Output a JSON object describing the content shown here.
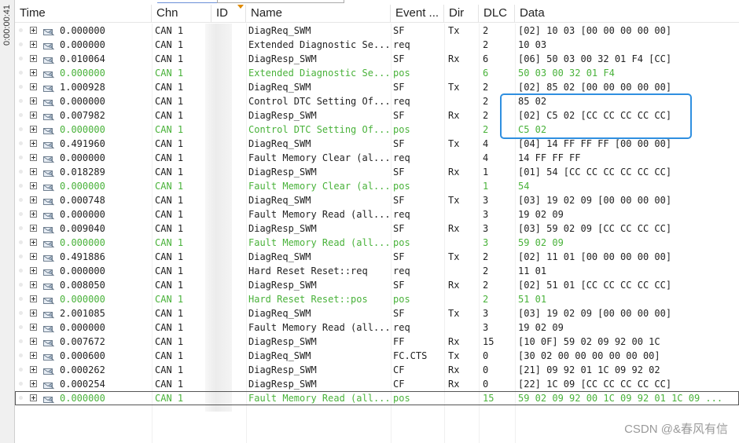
{
  "side_time": "0:00:00:41",
  "columns": {
    "time": "Time",
    "chn": "Chn",
    "id": "ID",
    "name": "Name",
    "event": "Event ...",
    "dir": "Dir",
    "dlc": "DLC",
    "data": "Data"
  },
  "rows": [
    {
      "time": "0.000000",
      "chn": "CAN 1",
      "name": "DiagReq_SWM",
      "event": "SF",
      "dir": "Tx",
      "dlc": "2",
      "data": "[02] 10 03 [00 00 00 00 00]",
      "green": false
    },
    {
      "time": "0.000000",
      "chn": "CAN 1",
      "name": "Extended Diagnostic Se...",
      "event": "req",
      "dir": "",
      "dlc": "2",
      "data": "10 03",
      "green": false
    },
    {
      "time": "0.010064",
      "chn": "CAN 1",
      "name": "DiagResp_SWM",
      "event": "SF",
      "dir": "Rx",
      "dlc": "6",
      "data": "[06] 50 03 00 32 01 F4 [CC]",
      "green": false
    },
    {
      "time": "0.000000",
      "chn": "CAN 1",
      "name": "Extended Diagnostic Se...",
      "event": "pos",
      "dir": "",
      "dlc": "6",
      "data": "50 03 00 32 01 F4",
      "green": true
    },
    {
      "time": "1.000928",
      "chn": "CAN 1",
      "name": "DiagReq_SWM",
      "event": "SF",
      "dir": "Tx",
      "dlc": "2",
      "data": "[02] 85 02 [00 00 00 00 00]",
      "green": false
    },
    {
      "time": "0.000000",
      "chn": "CAN 1",
      "name": "Control DTC Setting Of...",
      "event": "req",
      "dir": "",
      "dlc": "2",
      "data": "85 02",
      "green": false
    },
    {
      "time": "0.007982",
      "chn": "CAN 1",
      "name": "DiagResp_SWM",
      "event": "SF",
      "dir": "Rx",
      "dlc": "2",
      "data": "[02] C5 02 [CC CC CC CC CC]",
      "green": false
    },
    {
      "time": "0.000000",
      "chn": "CAN 1",
      "name": "Control DTC Setting Of...",
      "event": "pos",
      "dir": "",
      "dlc": "2",
      "data": "C5 02",
      "green": true
    },
    {
      "time": "0.491960",
      "chn": "CAN 1",
      "name": "DiagReq_SWM",
      "event": "SF",
      "dir": "Tx",
      "dlc": "4",
      "data": "[04] 14 FF FF FF [00 00 00]",
      "green": false
    },
    {
      "time": "0.000000",
      "chn": "CAN 1",
      "name": "Fault Memory Clear (al...",
      "event": "req",
      "dir": "",
      "dlc": "4",
      "data": "14 FF FF FF",
      "green": false
    },
    {
      "time": "0.018289",
      "chn": "CAN 1",
      "name": "DiagResp_SWM",
      "event": "SF",
      "dir": "Rx",
      "dlc": "1",
      "data": "[01] 54 [CC CC CC CC CC CC]",
      "green": false
    },
    {
      "time": "0.000000",
      "chn": "CAN 1",
      "name": "Fault Memory Clear (al...",
      "event": "pos",
      "dir": "",
      "dlc": "1",
      "data": "54",
      "green": true
    },
    {
      "time": "0.000748",
      "chn": "CAN 1",
      "name": "DiagReq_SWM",
      "event": "SF",
      "dir": "Tx",
      "dlc": "3",
      "data": "[03] 19 02 09 [00 00 00 00]",
      "green": false
    },
    {
      "time": "0.000000",
      "chn": "CAN 1",
      "name": "Fault Memory Read (all...",
      "event": "req",
      "dir": "",
      "dlc": "3",
      "data": "19 02 09",
      "green": false
    },
    {
      "time": "0.009040",
      "chn": "CAN 1",
      "name": "DiagResp_SWM",
      "event": "SF",
      "dir": "Rx",
      "dlc": "3",
      "data": "[03] 59 02 09 [CC CC CC CC]",
      "green": false
    },
    {
      "time": "0.000000",
      "chn": "CAN 1",
      "name": "Fault Memory Read (all...",
      "event": "pos",
      "dir": "",
      "dlc": "3",
      "data": "59 02 09",
      "green": true
    },
    {
      "time": "0.491886",
      "chn": "CAN 1",
      "name": "DiagReq_SWM",
      "event": "SF",
      "dir": "Tx",
      "dlc": "2",
      "data": "[02] 11 01 [00 00 00 00 00]",
      "green": false
    },
    {
      "time": "0.000000",
      "chn": "CAN 1",
      "name": "Hard Reset Reset::req",
      "event": "req",
      "dir": "",
      "dlc": "2",
      "data": "11 01",
      "green": false
    },
    {
      "time": "0.008050",
      "chn": "CAN 1",
      "name": "DiagResp_SWM",
      "event": "SF",
      "dir": "Rx",
      "dlc": "2",
      "data": "[02] 51 01 [CC CC CC CC CC]",
      "green": false
    },
    {
      "time": "0.000000",
      "chn": "CAN 1",
      "name": "Hard Reset Reset::pos",
      "event": "pos",
      "dir": "",
      "dlc": "2",
      "data": "51 01",
      "green": true
    },
    {
      "time": "2.001085",
      "chn": "CAN 1",
      "name": "DiagReq_SWM",
      "event": "SF",
      "dir": "Tx",
      "dlc": "3",
      "data": "[03] 19 02 09 [00 00 00 00]",
      "green": false
    },
    {
      "time": "0.000000",
      "chn": "CAN 1",
      "name": "Fault Memory Read (all...",
      "event": "req",
      "dir": "",
      "dlc": "3",
      "data": "19 02 09",
      "green": false
    },
    {
      "time": "0.007672",
      "chn": "CAN 1",
      "name": "DiagResp_SWM",
      "event": "FF",
      "dir": "Rx",
      "dlc": "15",
      "data": "[10 0F] 59 02 09 92 00 1C",
      "green": false
    },
    {
      "time": "0.000600",
      "chn": "CAN 1",
      "name": "DiagReq_SWM",
      "event": "FC.CTS",
      "dir": "Tx",
      "dlc": "0",
      "data": "[30 02 00 00 00 00 00 00]",
      "green": false
    },
    {
      "time": "0.000262",
      "chn": "CAN 1",
      "name": "DiagResp_SWM",
      "event": "CF",
      "dir": "Rx",
      "dlc": "0",
      "data": "[21] 09 92 01 1C 09 92 02",
      "green": false
    },
    {
      "time": "0.000254",
      "chn": "CAN 1",
      "name": "DiagResp_SWM",
      "event": "CF",
      "dir": "Rx",
      "dlc": "0",
      "data": "[22] 1C 09 [CC CC CC CC CC]",
      "green": false
    },
    {
      "time": "0.000000",
      "chn": "CAN 1",
      "name": "Fault Memory Read (all...",
      "event": "pos",
      "dir": "",
      "dlc": "15",
      "data": "59 02 09 92 00 1C 09 92 01 1C 09  ...",
      "green": true,
      "selected": true
    }
  ],
  "watermark": "CSDN @&春风有信",
  "colors": {
    "response_green": "#49b23a",
    "highlight_blue": "#2f8fe0"
  },
  "icons": {
    "expand": "plus-box-icon",
    "message": "can-message-icon"
  }
}
